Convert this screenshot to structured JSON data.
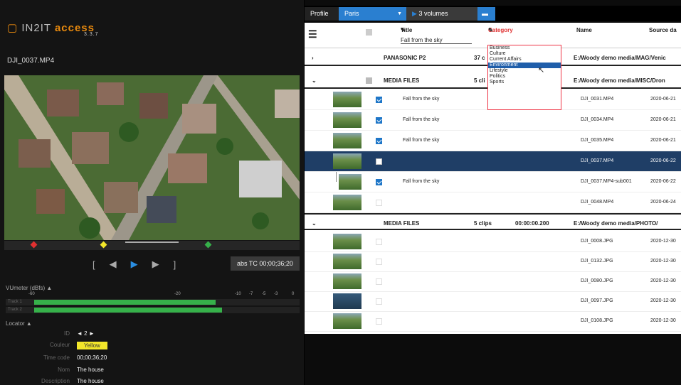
{
  "app": {
    "logo_brand": "IN2IT",
    "logo_product": "access",
    "version": "3.3.7"
  },
  "player": {
    "clip_name": "DJI_0037.MP4",
    "timecode": "abs TC 00;00;36;20",
    "transport": {
      "in": "[",
      "prev": "◀",
      "play": "▶",
      "next": "▶",
      "out": "]"
    },
    "vumeter": {
      "title": "VUmeter (dBfs) ▲",
      "scale": [
        "-60",
        "-20",
        "-10",
        "-7",
        "-5",
        "-3",
        "0"
      ],
      "tracks": [
        {
          "label": "Track 1",
          "level": 0.6
        },
        {
          "label": "Track 2",
          "level": 0.7
        }
      ]
    },
    "locator": {
      "title": "Locator ▲",
      "id_label": "ID",
      "id_value": "◄  2  ►",
      "color_label": "Couleur",
      "color_value": "Yellow",
      "timecode_label": "Time code",
      "timecode_value": "00;00;36;20",
      "name_label": "Nom",
      "name_value": "The house",
      "description_label": "Description",
      "description_value": "The house"
    }
  },
  "toolbar": {
    "profile": "Profile",
    "profile_value": "Paris",
    "volumes": "3 volumes"
  },
  "table": {
    "columns": {
      "title": "Title",
      "title_filter": "Fall from the sky",
      "category": "Category",
      "name": "Name",
      "source": "Source da"
    },
    "category_options": [
      "Business",
      "Culture",
      "Current Affairs",
      "Environment",
      "Lifestyle",
      "Politics",
      "Sports"
    ],
    "category_highlighted": "Environment",
    "groups": [
      {
        "name": "PANASONIC P2",
        "count": "37 c",
        "path": "E:/Woody demo media/MAG/Venic"
      },
      {
        "name": "MEDIA FILES",
        "count": "5 cli",
        "path": "E:/Woody demo media/MISC/Dron",
        "rows": [
          {
            "title": "Fall from the sky",
            "name": "DJI_0031.MP4",
            "date": "2020-06-21",
            "checked": true
          },
          {
            "title": "Fall from the sky",
            "name": "DJI_0034.MP4",
            "date": "2020-06-21",
            "checked": true
          },
          {
            "title": "Fall from the sky",
            "name": "DJI_0035.MP4",
            "date": "2020-06-21",
            "checked": true
          },
          {
            "title": "",
            "name": "DJI_0037.MP4",
            "date": "2020-06-22",
            "checked": false,
            "selected": true
          },
          {
            "title": "Fall from the sky",
            "name": "DJI_0037.MP4-sub001",
            "date": "2020-06-22",
            "checked": true
          },
          {
            "title": "",
            "name": "DJI_0048.MP4",
            "date": "2020-06-24",
            "checked": false
          }
        ]
      },
      {
        "name": "MEDIA FILES",
        "count": "5 clips",
        "duration": "00:00:00.200",
        "path": "E:/Woody demo media/PHOTO/",
        "rows": [
          {
            "name": "DJI_0008.JPG",
            "date": "2020-12-30"
          },
          {
            "name": "DJI_0132.JPG",
            "date": "2020-12-30"
          },
          {
            "name": "DJI_0080.JPG",
            "date": "2020-12-30"
          },
          {
            "name": "DJI_0097.JPG",
            "date": "2020-12-30"
          },
          {
            "name": "DJI_0108.JPG",
            "date": "2020-12-30"
          }
        ]
      }
    ]
  }
}
